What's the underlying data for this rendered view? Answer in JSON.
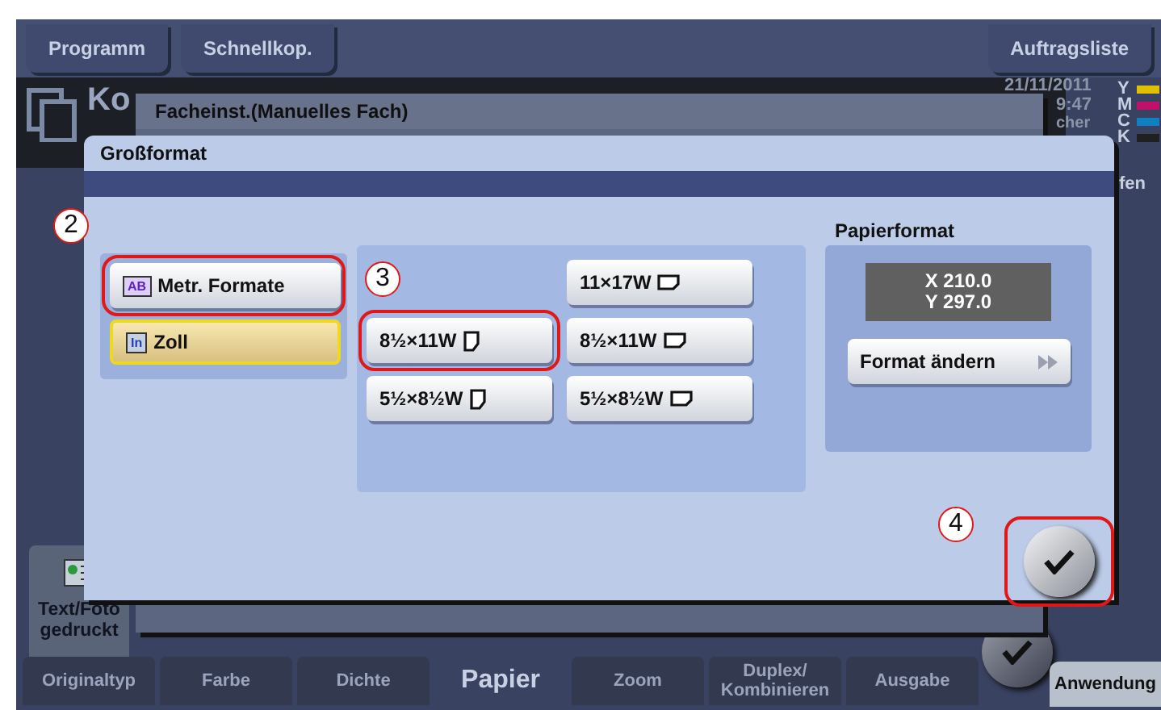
{
  "top_buttons": [
    {
      "label": "Programm"
    },
    {
      "label": "Schnellkop."
    },
    {
      "label": "Auftragsliste"
    }
  ],
  "status": {
    "title": "Ko",
    "date": "21/11/2011",
    "time": "9:47",
    "partial_left": "cher",
    "partial_right": "fen",
    "toners": [
      {
        "label": "Y",
        "color": "#e0c000"
      },
      {
        "label": "M",
        "color": "#c0106a"
      },
      {
        "label": "C",
        "color": "#1080c0"
      },
      {
        "label": "K",
        "color": "#202020"
      }
    ]
  },
  "original_type": {
    "lines": [
      "Text/Foto",
      "gedruckt"
    ]
  },
  "bottom_tabs": [
    {
      "label": "Originaltyp",
      "selected": false
    },
    {
      "label": "Farbe",
      "selected": false
    },
    {
      "label": "Dichte",
      "selected": false
    },
    {
      "label": "Papier",
      "selected": true
    },
    {
      "label": "Zoom",
      "selected": false
    },
    {
      "label": "Duplex/\nKombinieren",
      "selected": false
    },
    {
      "label": "Ausgabe",
      "selected": false
    }
  ],
  "apply_button": {
    "label": "Anwendung"
  },
  "tray_dialog": {
    "title": "Facheinst.(Manuelles Fach)"
  },
  "size_dialog": {
    "title": "Großformat",
    "format_groups": [
      {
        "label": "Metr. Formate",
        "badge": "AB",
        "selected": false,
        "highlighted": true
      },
      {
        "label": "Zoll",
        "badge": "In",
        "selected": true,
        "highlighted": false
      }
    ],
    "sizes": [
      {
        "label": "11×17W",
        "kind": "landscape",
        "highlighted": false
      },
      {
        "label": "8½×11W",
        "kind": "portrait",
        "highlighted": true
      },
      {
        "label": "8½×11W",
        "kind": "landscape",
        "highlighted": false
      },
      {
        "label": "5½×8½W",
        "kind": "portrait",
        "highlighted": false
      },
      {
        "label": "5½×8½W",
        "kind": "landscape",
        "highlighted": false
      }
    ],
    "paper_format": {
      "label": "Papierformat",
      "x": "X 210.0",
      "y": "Y 297.0",
      "change_button": "Format ändern"
    },
    "ok_button": {
      "highlighted": true
    }
  },
  "callouts": [
    {
      "number": "2"
    },
    {
      "number": "3"
    },
    {
      "number": "4"
    }
  ]
}
